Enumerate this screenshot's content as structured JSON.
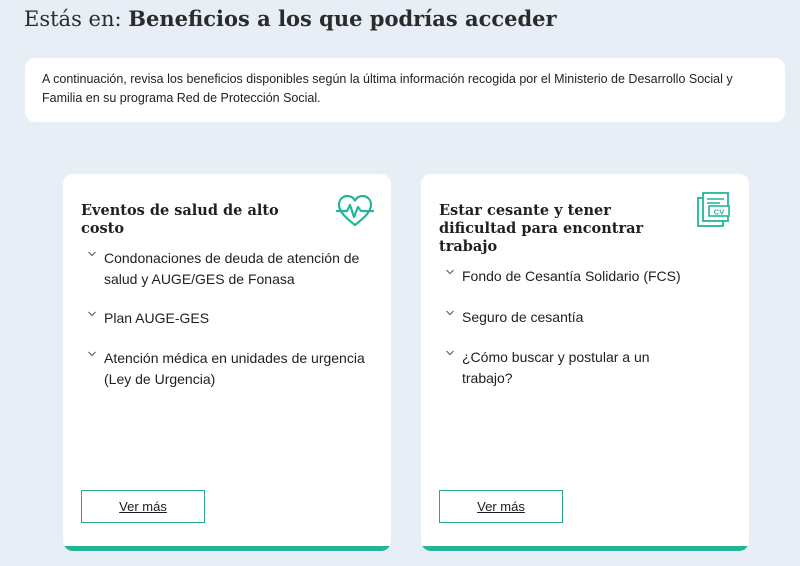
{
  "header": {
    "prefix": "Estás en:",
    "title": "Beneficios a los que podrías acceder"
  },
  "intro": {
    "text": "A continuación, revisa los beneficios disponibles según la última información recogida por el Ministerio de Desarrollo Social y Familia en su programa Red de Protección Social."
  },
  "cards": [
    {
      "title": "Eventos de salud de alto costo",
      "icon": "heart-pulse-icon",
      "items": [
        "Condonaciones de deuda de atención de salud y AUGE/GES de Fonasa",
        "Plan AUGE-GES",
        "Atención médica en unidades de urgencia (Ley de Urgencia)"
      ],
      "button": "Ver más"
    },
    {
      "title": "Estar cesante y tener dificultad para encontrar trabajo",
      "icon": "cv-document-icon",
      "icon_text": "CV",
      "items": [
        "Fondo de Cesantía Solidario (FCS)",
        "Seguro de cesantía",
        "¿Cómo buscar y postular a un trabajo?"
      ],
      "button": "Ver más"
    }
  ],
  "colors": {
    "background": "#e7eef6",
    "accent": "#22b59a",
    "button_border": "#2aa58e"
  }
}
